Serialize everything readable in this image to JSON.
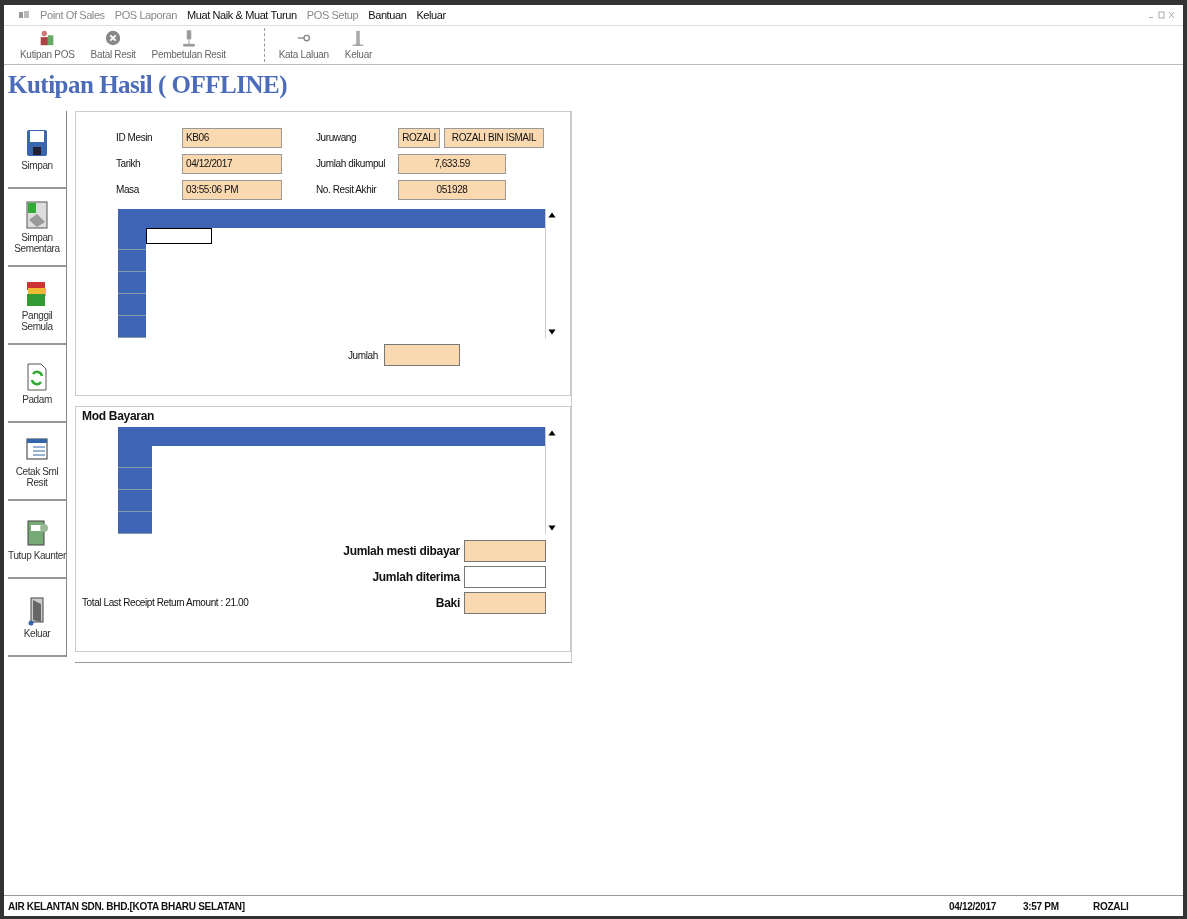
{
  "menu": [
    {
      "label": "Point Of Sales",
      "disabled": true
    },
    {
      "label": "POS Laporan",
      "disabled": true
    },
    {
      "label": "Muat Naik & Muat Turun",
      "disabled": false
    },
    {
      "label": "POS Setup",
      "disabled": true
    },
    {
      "label": "Bantuan",
      "disabled": false
    },
    {
      "label": "Keluar",
      "disabled": false
    }
  ],
  "toolbar": [
    {
      "label": "Kutipan POS",
      "kind": "people"
    },
    {
      "label": "Batal Resit",
      "kind": "cancel"
    },
    {
      "label": "Pembetulan Resit",
      "kind": "microscope"
    },
    {
      "label": "Kata Laluan",
      "kind": "key"
    },
    {
      "label": "Keluar",
      "kind": "exit"
    }
  ],
  "page_title": "Kutipan Hasil ( OFFLINE)",
  "sidebar": [
    {
      "label": "Simpan",
      "kind": "floppy"
    },
    {
      "label": "Simpan Sementara",
      "kind": "map"
    },
    {
      "label": "Panggil Semula",
      "kind": "books"
    },
    {
      "label": "Padam",
      "kind": "recycle"
    },
    {
      "label": "Cetak Sml Resit",
      "kind": "form"
    },
    {
      "label": "Tutup Kaunter",
      "kind": "register"
    },
    {
      "label": "Keluar",
      "kind": "door"
    }
  ],
  "info_left": [
    {
      "label": "ID Mesin",
      "value": "KB06"
    },
    {
      "label": "Tarikh",
      "value": "04/12/2017"
    },
    {
      "label": "Masa",
      "value": "03:55:06 PM"
    }
  ],
  "info_right": [
    {
      "label": "Juruwang",
      "values": [
        "ROZALI",
        "ROZALI BIN ISMAIL"
      ]
    },
    {
      "label": "Jumlah dikumpul",
      "values": [
        "7,633.59"
      ]
    },
    {
      "label": "No. Resit Akhir",
      "values": [
        "051928"
      ]
    }
  ],
  "items_grid": {
    "rows": [
      {
        "selected": true
      },
      {
        "selected": false
      },
      {
        "selected": false
      },
      {
        "selected": false
      },
      {
        "selected": false
      }
    ]
  },
  "jumlah": {
    "label": "Jumlah",
    "kind": "readonly"
  },
  "payment": {
    "title": "Mod Bayaran",
    "grid": {
      "rows": [
        {
          "selected": false
        },
        {
          "selected": false
        },
        {
          "selected": false
        },
        {
          "selected": false
        }
      ]
    },
    "totals": [
      {
        "label": "Jumlah mesti dibayar",
        "kind": "readonly"
      },
      {
        "label": "Jumlah diterima",
        "kind": "input"
      },
      {
        "label": "Baki",
        "kind": "readonly"
      }
    ],
    "note": "Total Last Receipt Return Amount : 21.00"
  },
  "status_bar": {
    "company": "AIR KELANTAN SDN. BHD.[KOTA BHARU SELATAN]",
    "date": "04/12/2017",
    "time": "3:57 PM",
    "user": "ROZALI"
  }
}
